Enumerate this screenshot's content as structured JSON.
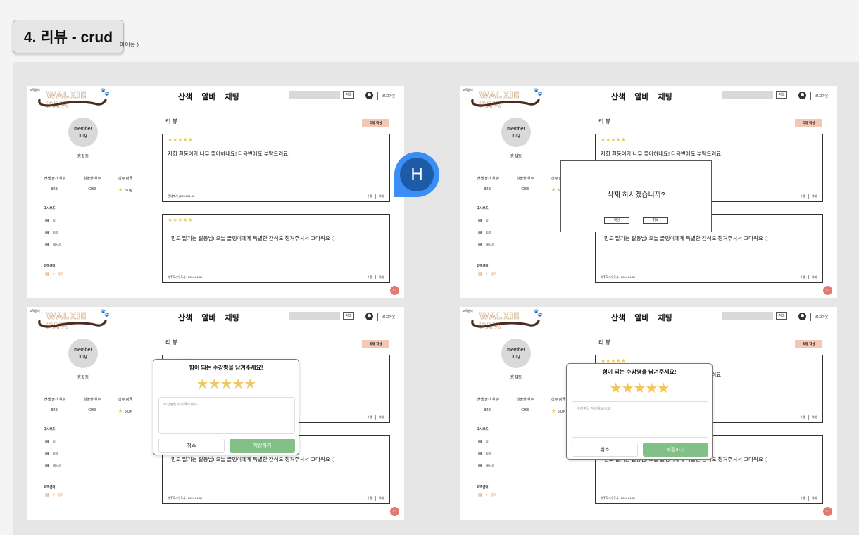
{
  "section_title": "4. 리뷰 - crud",
  "title_tail": "아이콘 )",
  "header": {
    "customer_center_top": "고객센터",
    "logo_text_a": "WALKIE PAW",
    "nav": [
      "산책",
      "알바",
      "채팅"
    ],
    "search_button": "검색",
    "logout": "로그아웃"
  },
  "sidebar": {
    "avatar_label": "member\nimg",
    "member_name": "홍길동",
    "stats": [
      {
        "label": "산책 맡긴 횟수",
        "value": "82회"
      },
      {
        "label": "알바한 횟수",
        "value": "428회"
      },
      {
        "label": "리뷰 평균",
        "value": "5.0점"
      }
    ],
    "dashboard_head": "대시보드",
    "menu": [
      "홈",
      "리뷰",
      "게시글"
    ],
    "support_head": "고객센터",
    "support_item": "1:1 문의"
  },
  "main": {
    "section_heading": "리 뷰",
    "write_button": "리뷰 작성",
    "reviews": [
      {
        "stars": "★★★★★",
        "text": "저희 흰둥이가 너무 좋아하네요! 다음번에도 부탁드려요!",
        "meta_author": "관세계서",
        "meta_date": "2024.01.31"
      },
      {
        "stars": "★★★★★",
        "text": "믿고 맡기는 길동님! 오늘 골댕이에게 특별한 간식도 챙겨주셔서 고마워요 :)",
        "meta_author": "제주도시우도사",
        "meta_date": "2024.01.31"
      }
    ],
    "edit_label": "수정",
    "delete_label": "삭제"
  },
  "delete_modal": {
    "message": "삭제 하시겠습니까?",
    "confirm": "확인",
    "cancel": "취소"
  },
  "review_modal": {
    "question": "힘이 되는 수강평을 남겨주세요!",
    "stars": "★★★★★",
    "placeholder": "수강평을 작성해보세요!",
    "cancel": "취소",
    "save": "저장하기"
  },
  "floating_avatar": "H",
  "colors": {
    "star": "#f2c94c",
    "write_button": "#f1c7b5",
    "save_button": "#82c088",
    "active_menu": "#e8964d",
    "fab": "#e07a6e",
    "floating_avatar_outer": "#3b8ef5",
    "floating_avatar_inner": "#1d5aa8"
  },
  "icons": [
    "user-icon",
    "paw-icon",
    "star-icon",
    "home-icon",
    "review-icon",
    "post-icon",
    "inquiry-icon",
    "chat-fab-icon"
  ]
}
